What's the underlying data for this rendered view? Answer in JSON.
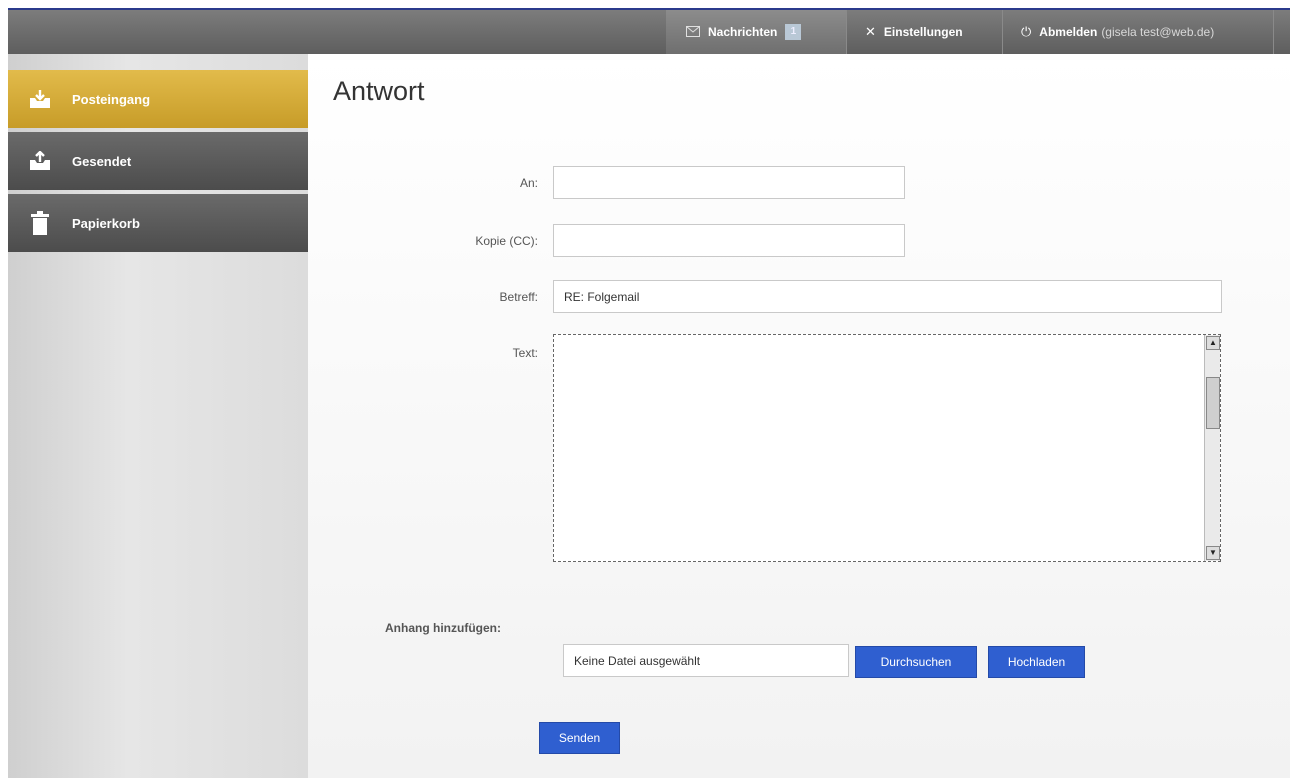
{
  "topbar": {
    "messages_label": "Nachrichten",
    "messages_count": "1",
    "settings_label": "Einstellungen",
    "logout_label": "Abmelden",
    "logout_user": "(gisela test@web.de)"
  },
  "icons": {
    "messages": "envelope-icon",
    "settings": "tools-icon",
    "logout": "power-icon",
    "inbox": "inbox-tray-icon",
    "sent": "outbox-tray-icon",
    "trash": "trash-icon"
  },
  "sidebar": {
    "items": [
      {
        "label": "Posteingang",
        "active": true
      },
      {
        "label": "Gesendet",
        "active": false
      },
      {
        "label": "Papierkorb",
        "active": false
      }
    ]
  },
  "main": {
    "title": "Antwort",
    "form": {
      "to_label": "An:",
      "to_value": "",
      "cc_label": "Kopie (CC):",
      "cc_value": "",
      "subject_label": "Betreff:",
      "subject_value": "RE: Folgemail",
      "text_label": "Text:",
      "text_value": ""
    },
    "attachment": {
      "label": "Anhang hinzufügen:",
      "file_value": "Keine Datei ausgewählt",
      "browse_label": "Durchsuchen",
      "upload_label": "Hochladen"
    },
    "send_label": "Senden"
  },
  "colors": {
    "active_sidebar": "#d4aa3a",
    "inactive_sidebar": "#5a5a5a",
    "button_blue": "#2f5fd0",
    "topbar": "#6b6b6b"
  }
}
